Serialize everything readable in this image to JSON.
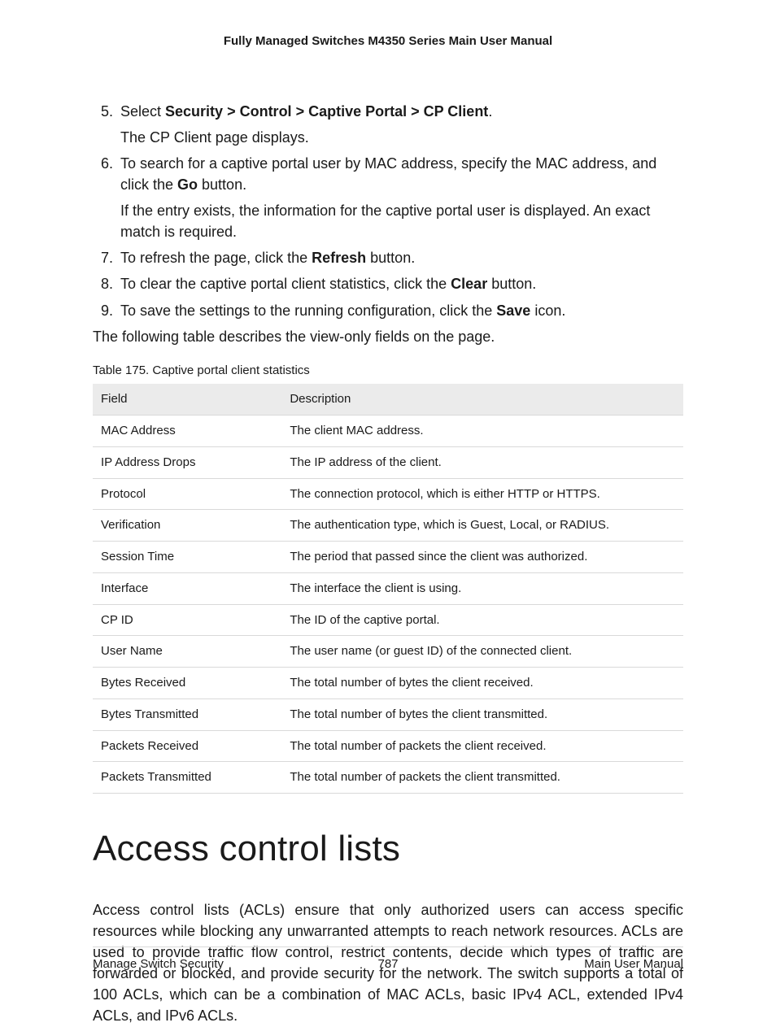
{
  "header": {
    "running_title": "Fully Managed Switches M4350 Series Main User Manual"
  },
  "steps": {
    "s5": {
      "prefix": "Select ",
      "path": "Security > Control > Captive Portal > CP Client",
      "suffix": ".",
      "sub": "The CP Client page displays."
    },
    "s6": {
      "line1a": "To search for a captive portal user by MAC address, specify the MAC address, and click the ",
      "go": "Go",
      "line1b": " button.",
      "sub": "If the entry exists, the information for the captive portal user is displayed. An exact match is required."
    },
    "s7": {
      "a": "To refresh the page, click the ",
      "refresh": "Refresh",
      "b": " button."
    },
    "s8": {
      "a": "To clear the captive portal client statistics, click the ",
      "clear": "Clear",
      "b": " button."
    },
    "s9": {
      "a": "To save the settings to the running configuration, click the ",
      "save": "Save",
      "b": " icon."
    }
  },
  "after_steps": "The following table describes the view-only fields on the page.",
  "table": {
    "caption": "Table 175. Captive portal client statistics",
    "head": {
      "c1": "Field",
      "c2": "Description"
    },
    "rows": [
      {
        "c1": "MAC Address",
        "c2": "The client MAC address."
      },
      {
        "c1": "IP Address Drops",
        "c2": "The IP address of the client."
      },
      {
        "c1": "Protocol",
        "c2": "The connection protocol, which is either HTTP or HTTPS."
      },
      {
        "c1": "Verification",
        "c2": "The authentication type, which is Guest, Local, or RADIUS."
      },
      {
        "c1": "Session Time",
        "c2": "The period that passed since the client was authorized."
      },
      {
        "c1": "Interface",
        "c2": "The interface the client is using."
      },
      {
        "c1": "CP ID",
        "c2": "The ID of the captive portal."
      },
      {
        "c1": "User Name",
        "c2": "The user name (or guest ID) of the connected client."
      },
      {
        "c1": "Bytes Received",
        "c2": "The total number of bytes the client received."
      },
      {
        "c1": "Bytes Transmitted",
        "c2": "The total number of bytes the client transmitted."
      },
      {
        "c1": "Packets Received",
        "c2": "The total number of packets the client received."
      },
      {
        "c1": "Packets Transmitted",
        "c2": "The total number of packets the client transmitted."
      }
    ]
  },
  "section": {
    "title": "Access control lists",
    "para": "Access control lists (ACLs) ensure that only authorized users can access specific resources while blocking any unwarranted attempts to reach network resources. ACLs are used to provide traffic flow control, restrict contents, decide which types of traffic are forwarded or blocked, and provide security for the network. The switch supports a total of 100 ACLs, which can be a combination of MAC ACLs, basic IPv4 ACL, extended IPv4 ACLs, and IPv6 ACLs."
  },
  "footer": {
    "left": "Manage Switch Security",
    "page": "787",
    "right": "Main User Manual"
  }
}
